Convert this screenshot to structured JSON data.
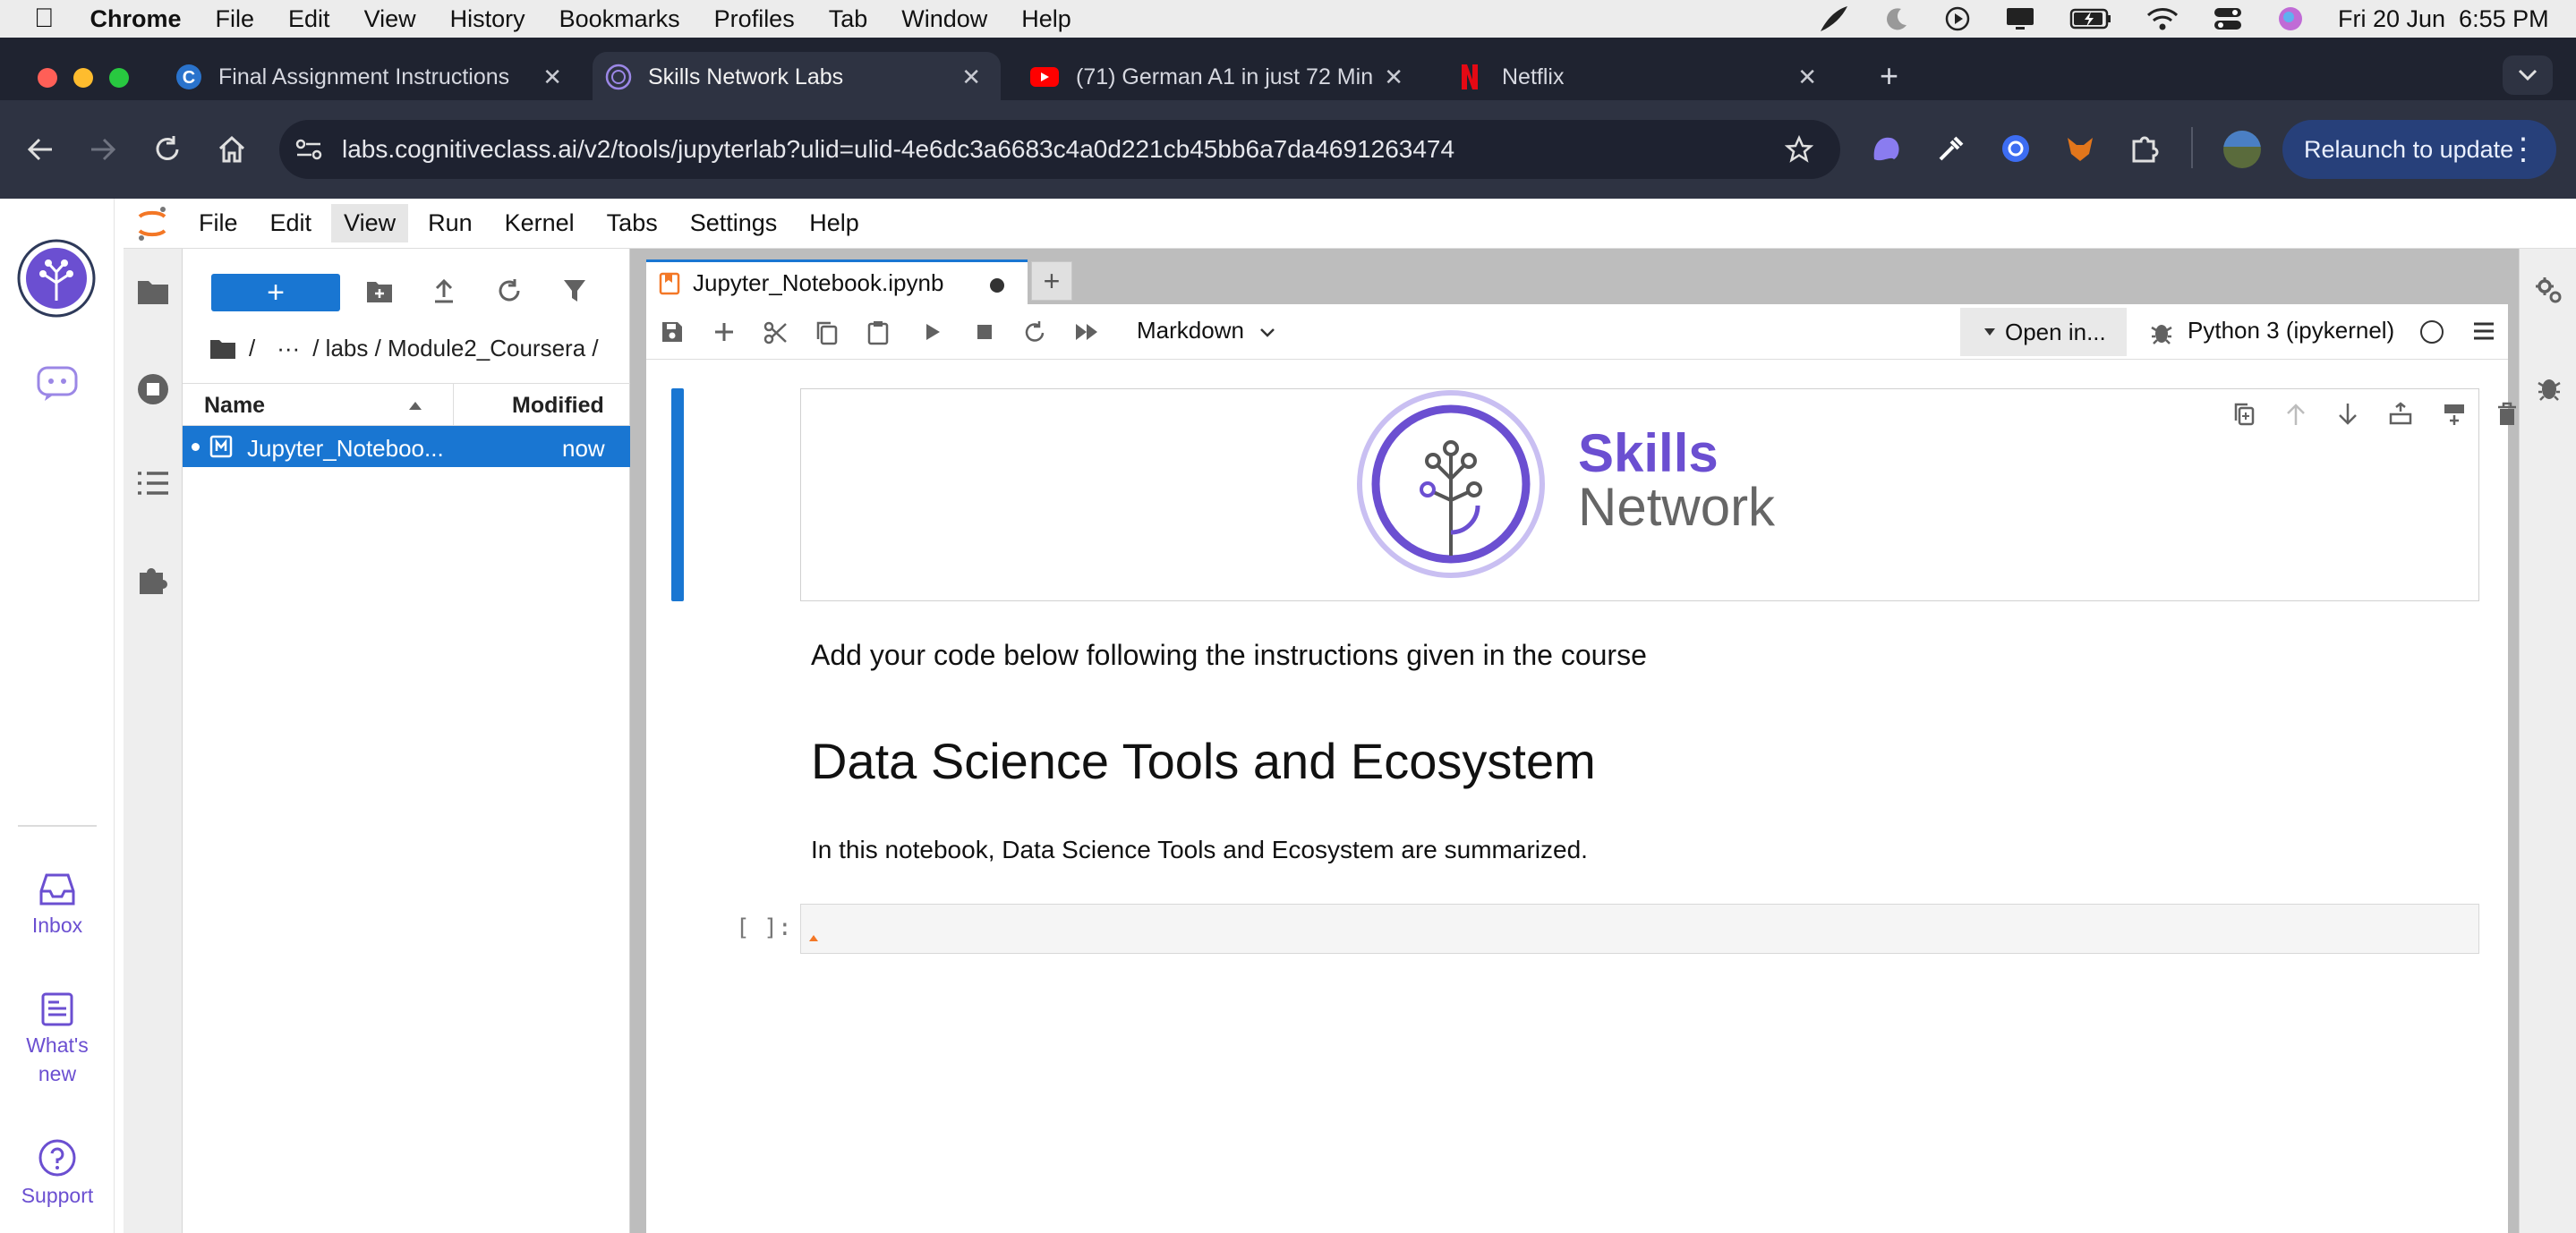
{
  "mac_menu": {
    "app": "Chrome",
    "items": [
      "File",
      "Edit",
      "View",
      "History",
      "Bookmarks",
      "Profiles",
      "Tab",
      "Window",
      "Help"
    ],
    "clock": "Fri 20 Jun  6:55 PM"
  },
  "browser": {
    "tabs": [
      {
        "title": "Final Assignment Instructions",
        "icon": "coursera-icon"
      },
      {
        "title": "Skills Network Labs",
        "icon": "skills-network-icon"
      },
      {
        "title": "(71) German A1 in just 72 Min",
        "icon": "youtube-icon"
      },
      {
        "title": "Netflix",
        "icon": "netflix-icon"
      }
    ],
    "url": "labs.cognitiveclass.ai/v2/tools/jupyterlab?ulid=ulid-4e6dc3a6683c4a0d221cb45bb6a7da4691263474",
    "relaunch_label": "Relaunch to update"
  },
  "rail": {
    "inbox_label": "Inbox",
    "whats_new_label": "What's new",
    "support_label": "Support"
  },
  "jupyter_menu": [
    "File",
    "Edit",
    "View",
    "Run",
    "Kernel",
    "Tabs",
    "Settings",
    "Help"
  ],
  "file_browser": {
    "new_label": "+",
    "breadcrumb": [
      "/",
      "···",
      "/ labs / Module2_Coursera /"
    ],
    "col_name": "Name",
    "col_modified": "Modified",
    "files": [
      {
        "name": "Jupyter_Noteboo...",
        "modified": "now"
      }
    ]
  },
  "notebook": {
    "tab_title": "Jupyter_Notebook.ipynb",
    "cell_type": "Markdown",
    "open_in": "Open in...",
    "kernel": "Python 3 (ipykernel)",
    "logo_word1": "Skills",
    "logo_word2": "Network",
    "instruction": "Add your code below following the instructions given in the course",
    "heading": "Data Science Tools and Ecosystem",
    "intro": "In this notebook, Data Science Tools and Ecosystem are summarized.",
    "prompt": "[ ]:"
  },
  "colors": {
    "accent": "#1976d2",
    "skills_purple": "#6b4fd1"
  }
}
